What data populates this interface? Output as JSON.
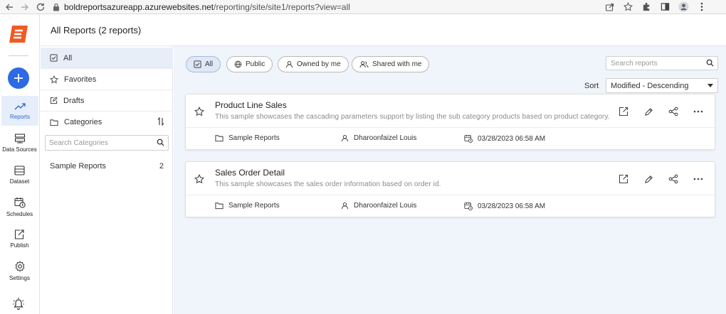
{
  "browser": {
    "url_host": "boldreportsazureapp.azurewebsites.net",
    "url_path": "/reporting/site/site1/reports?view=all"
  },
  "rail": {
    "items": [
      {
        "label": "Reports",
        "icon": "trend-icon"
      },
      {
        "label": "Data Sources",
        "icon": "server-icon"
      },
      {
        "label": "Dataset",
        "icon": "dataset-icon"
      },
      {
        "label": "Schedules",
        "icon": "calendar-clock-icon"
      },
      {
        "label": "Publish",
        "icon": "publish-icon"
      },
      {
        "label": "Settings",
        "icon": "gear-icon"
      }
    ],
    "accent": "#2d6ae3",
    "logo_color": "#f15a24"
  },
  "header": {
    "title": "All Reports (2 reports)"
  },
  "filters": {
    "items": [
      {
        "label": "All",
        "icon": "checkbox-icon"
      },
      {
        "label": "Favorites",
        "icon": "star-icon"
      },
      {
        "label": "Drafts",
        "icon": "edit-square-icon"
      },
      {
        "label": "Categories",
        "icon": "folder-icon"
      }
    ],
    "category_search_placeholder": "Search Categories",
    "categories": [
      {
        "name": "Sample Reports",
        "count": "2"
      }
    ]
  },
  "toolbar": {
    "chips": [
      {
        "label": "All",
        "icon": "checkbox-icon"
      },
      {
        "label": "Public",
        "icon": "globe-icon"
      },
      {
        "label": "Owned by me",
        "icon": "user-icon"
      },
      {
        "label": "Shared with me",
        "icon": "users-icon"
      }
    ],
    "search_placeholder": "Search reports",
    "sort_label": "Sort",
    "sort_value": "Modified - Descending"
  },
  "reports": [
    {
      "title": "Product Line Sales",
      "description": "This sample showcases the cascading parameters support by listing the sub category products based on product category.",
      "category": "Sample Reports",
      "owner": "Dharoonfaizel Louis",
      "modified": "03/28/2023 06:58 AM"
    },
    {
      "title": "Sales Order Detail",
      "description": "This sample showcases the sales order information based on order id.",
      "category": "Sample Reports",
      "owner": "Dharoonfaizel Louis",
      "modified": "03/28/2023 06:58 AM"
    }
  ]
}
